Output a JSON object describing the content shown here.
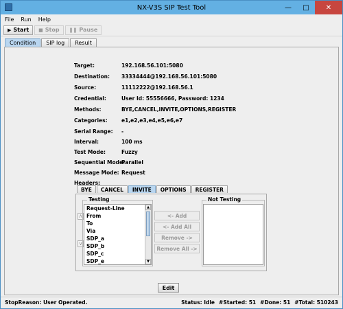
{
  "window": {
    "title": "NX-V3S SIP Test Tool"
  },
  "menu": [
    "File",
    "Run",
    "Help"
  ],
  "toolbar": {
    "start_label": "Start",
    "stop_label": "Stop",
    "pause_label": "Pause"
  },
  "tabs": [
    "Condition",
    "SIP log",
    "Result"
  ],
  "condition": [
    {
      "key": "Target:",
      "value": "192.168.56.101:5080"
    },
    {
      "key": "Destination:",
      "value": "33334444@192.168.56.101:5080"
    },
    {
      "key": "Source:",
      "value": "11112222@192.168.56.1"
    },
    {
      "key": "Credential:",
      "value": "User Id: 55556666, Password: 1234"
    },
    {
      "key": "Methods:",
      "value": "BYE,CANCEL,INVITE,OPTIONS,REGISTER"
    },
    {
      "key": "Categories:",
      "value": "e1,e2,e3,e4,e5,e6,e7"
    },
    {
      "key": "Serial Range:",
      "value": "-"
    },
    {
      "key": "Interval:",
      "value": "100 ms"
    },
    {
      "key": "Test Mode:",
      "value": "Fuzzy"
    },
    {
      "key": "Sequential Mode:",
      "value": "Parallel"
    },
    {
      "key": "Message Mode:",
      "value": "Request"
    },
    {
      "key": "Headers:",
      "value": ""
    }
  ],
  "header_tabs": [
    "BYE",
    "CANCEL",
    "INVITE",
    "OPTIONS",
    "REGISTER"
  ],
  "testing": {
    "legend": "Testing",
    "items": [
      "Request-Line",
      "From",
      "To",
      "Via",
      "SDP_a",
      "SDP_b",
      "SDP_c",
      "SDP_e"
    ]
  },
  "not_testing": {
    "legend": "Not Testing"
  },
  "move_buttons": {
    "add": "<- Add",
    "add_all": "<- Add All",
    "remove": "Remove ->",
    "remove_all": "Remove All ->"
  },
  "edit_label": "Edit",
  "status": {
    "reason": "StopReason: User Operated.",
    "state": "Status: Idle",
    "started": "#Started: 51",
    "done": "#Done: 51",
    "total": "#Total: 510243"
  }
}
